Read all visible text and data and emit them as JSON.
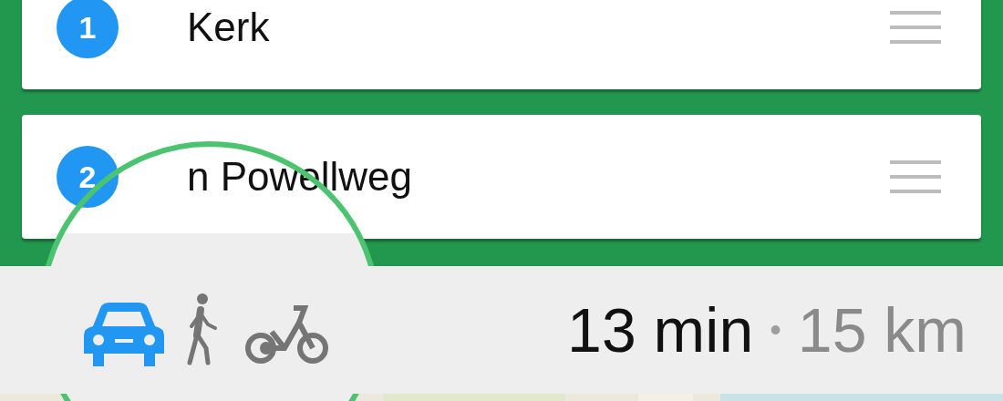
{
  "stops": [
    {
      "number": "1",
      "name": "Kerk"
    },
    {
      "number": "2",
      "name": "n Powellweg"
    }
  ],
  "travel_modes": [
    {
      "kind": "car",
      "selected": true
    },
    {
      "kind": "walk",
      "selected": false
    },
    {
      "kind": "bike",
      "selected": false
    }
  ],
  "duration": "13 min",
  "separator": "•",
  "distance": "15 km"
}
